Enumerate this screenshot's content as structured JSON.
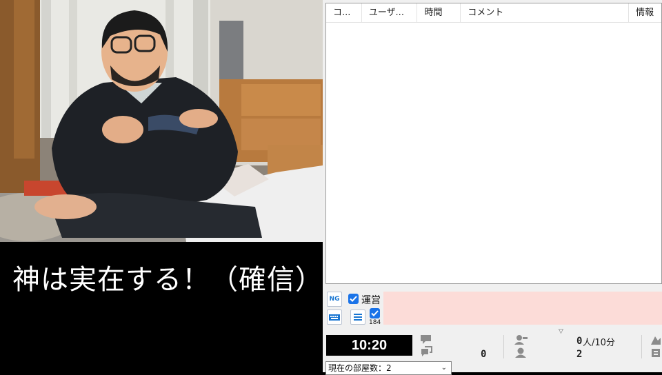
{
  "caption": {
    "text": "神は実在する！（確信）"
  },
  "comment_table": {
    "columns": [
      "コ...",
      "ユーザ...",
      "時間",
      "コメント",
      "情報"
    ]
  },
  "post_panel": {
    "ng_label": "NG",
    "admin_label": "運営",
    "anon_label": "184"
  },
  "stats": {
    "elapsed_time": "10:20",
    "comment_count": "0",
    "active_viewers": "0",
    "visitors_label": "人/10分",
    "total_viewers": "2",
    "room_count": "現在の部屋数：2"
  }
}
